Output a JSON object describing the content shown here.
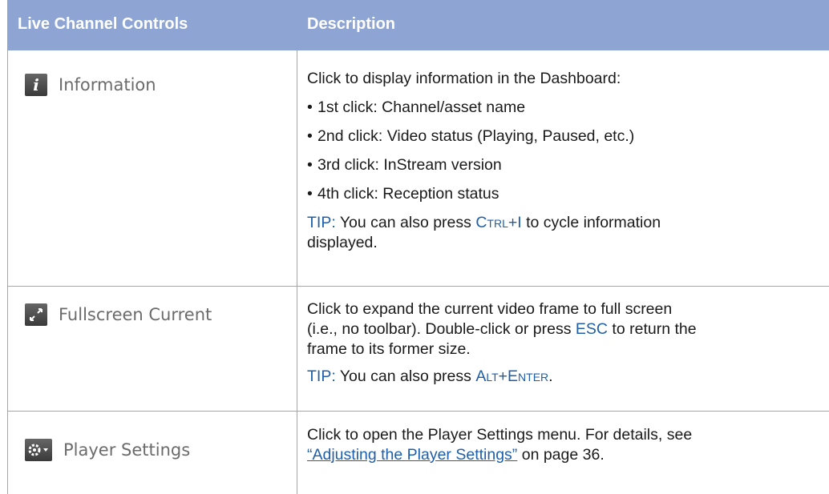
{
  "header": {
    "col1": "Live Channel Controls",
    "col2": "Description"
  },
  "rows": [
    {
      "icon": "info-icon",
      "label": "Information",
      "intro": "Click to display information in the Dashboard:",
      "bullets": [
        "1st click: Channel/asset name",
        "2nd click: Video status (Playing, Paused, etc.)",
        "3rd click: InStream version",
        "4th click: Reception status"
      ],
      "tip_label": "TIP:",
      "tip_pre": "You can also press",
      "tip_key": "Ctrl+I",
      "tip_post": "to cycle information",
      "tip_post2": "displayed."
    },
    {
      "icon": "fullscreen-icon",
      "label": "Fullscreen Current",
      "line1": "Click to expand the current video frame to full screen",
      "line2_pre": "(i.e., no toolbar). Double-click or press",
      "line2_key": "ESC",
      "line2_post": "to return the",
      "line3": "frame to its former size.",
      "tip_label": "TIP:",
      "tip_pre": "You can also press",
      "tip_key": "Alt+Enter",
      "tip_post": "."
    },
    {
      "icon": "gear-dropdown-icon",
      "label": "Player Settings",
      "line1": "Click to open the Player Settings menu. For details, see",
      "link_text": "“Adjusting the Player Settings”",
      "line2_post": "on page 36."
    }
  ]
}
